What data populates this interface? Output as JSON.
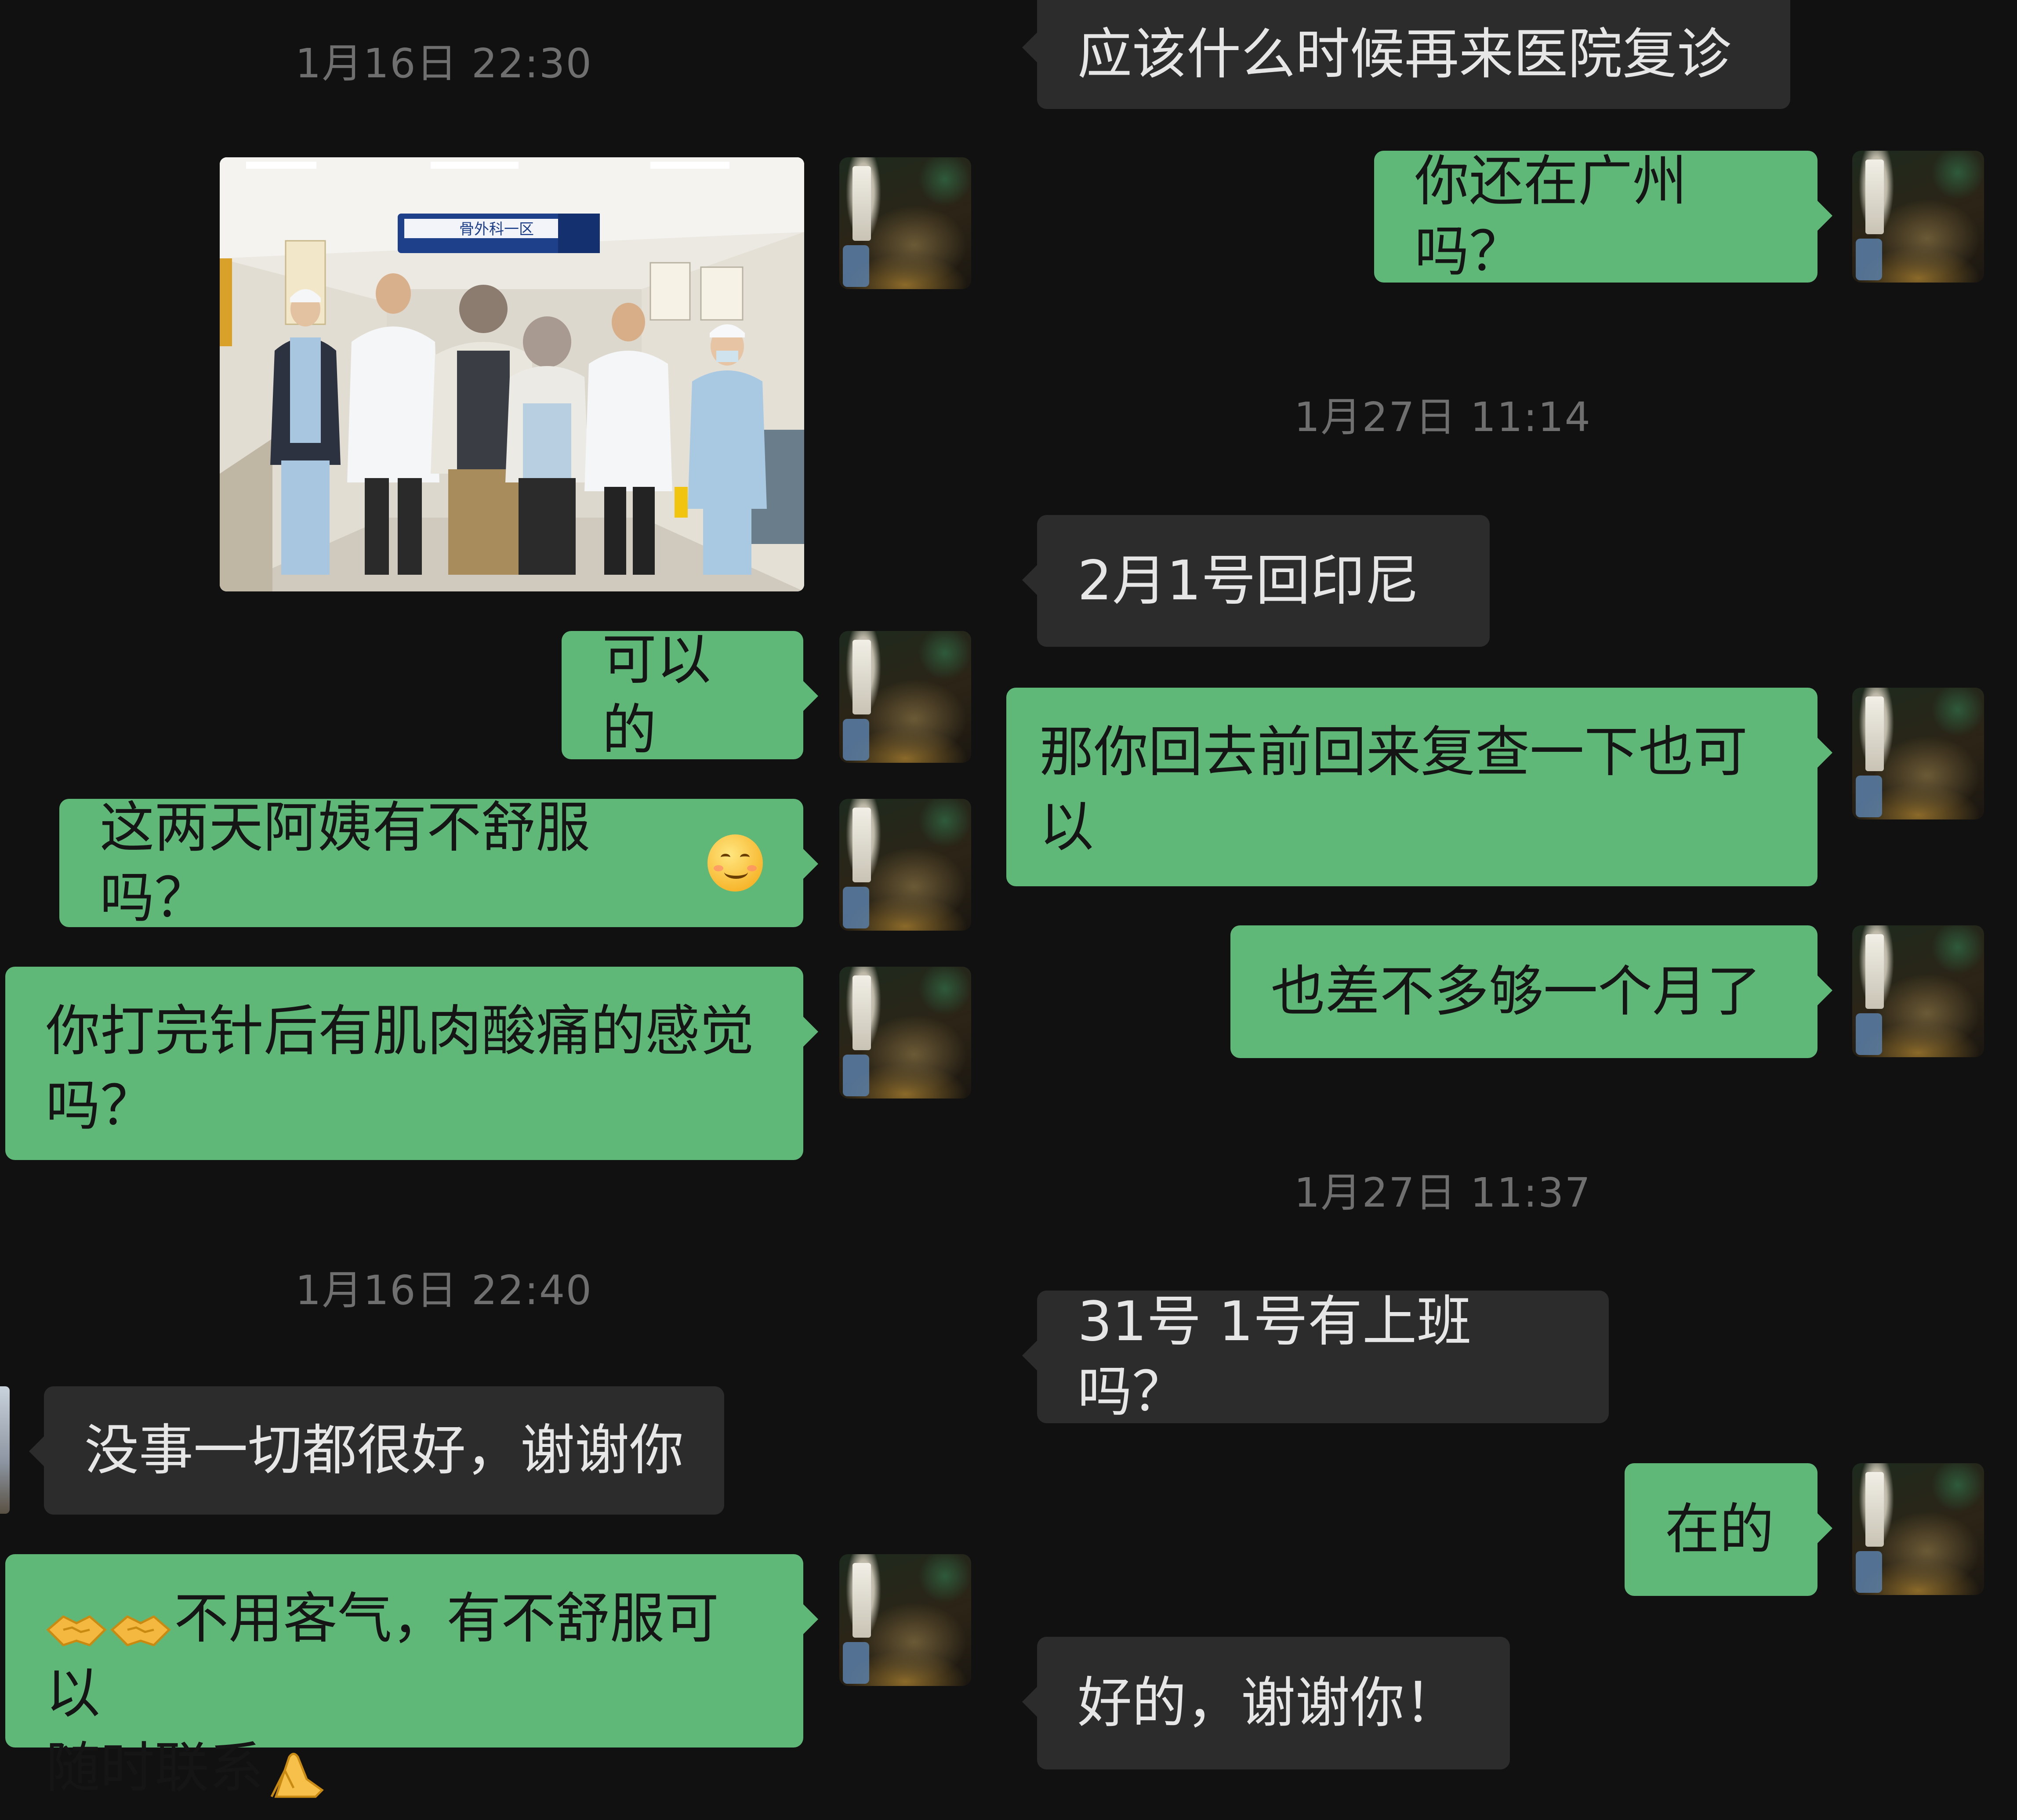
{
  "left": {
    "timestamp1": "1月16日 22:30",
    "msg_ok": "可以的",
    "msg_discomfort": "这两天阿姨有不舒服吗？",
    "msg_muscle_line1": "你打完针后有肌肉酸痛的感觉",
    "msg_muscle_line2": "吗？",
    "timestamp2": "1月16日 22:40",
    "msg_fine": "没事一切都很好，谢谢你",
    "msg_welcome_line1": "不用客气，有不舒服可以",
    "msg_welcome_line2": "随时联系",
    "photo_sign": "骨外科一区"
  },
  "right": {
    "msg_revisit": "应该什么时候再来医院复诊",
    "msg_guangzhou": "你还在广州吗？",
    "timestamp1": "1月27日 11:14",
    "msg_indonesia": "2月1号回印尼",
    "msg_recheck_line1": "那你回去前回来复查一下也可",
    "msg_recheck_line2": "以",
    "msg_month": "也差不多够一个月了",
    "timestamp2": "1月27日 11:37",
    "msg_work": "31号 1号有上班吗？",
    "msg_yes": "在的",
    "msg_thanks": "好的，谢谢你！"
  },
  "colors": {
    "background": "#111111",
    "outgoing_bubble": "#5fb878",
    "incoming_bubble": "#2c2c2c",
    "timestamp": "#6f6f6f"
  },
  "icons": {
    "smile": "smiling-face-emoji",
    "handshake": "handshake-emoji",
    "pray": "folded-hands-emoji"
  }
}
